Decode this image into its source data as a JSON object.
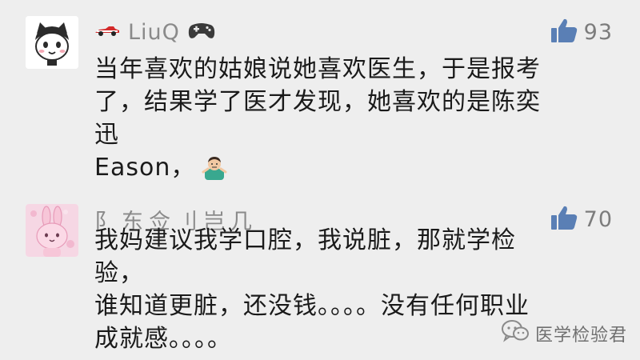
{
  "comments": [
    {
      "username": "LiuQ",
      "avatar_icon": "cartoon-cat-avatar",
      "badge_icons": [
        "race-car-icon",
        "gamepad-icon"
      ],
      "likes": "93",
      "text": "当年喜欢的姑娘说她喜欢医生，于是报考\n了，结果学了医才发现，她喜欢的是陈奕迅\nEason，",
      "trailing_emoji": "person-shrugging-emoji"
    },
    {
      "username": "阝东佥刂岂几",
      "avatar_icon": "pink-bunny-avatar",
      "likes": "70",
      "text": "我妈建议我学口腔，我说脏，那就学检验，\n谁知道更脏，还没钱。。。。没有任何职业\n成就感。。。。"
    }
  ],
  "watermark": {
    "icon": "wechat-icon",
    "text": "医学检验君"
  },
  "colors": {
    "background": "#eeeeee",
    "username": "#8a8a8a",
    "text": "#1a1a1a",
    "like_icon": "#5a7fb5"
  }
}
